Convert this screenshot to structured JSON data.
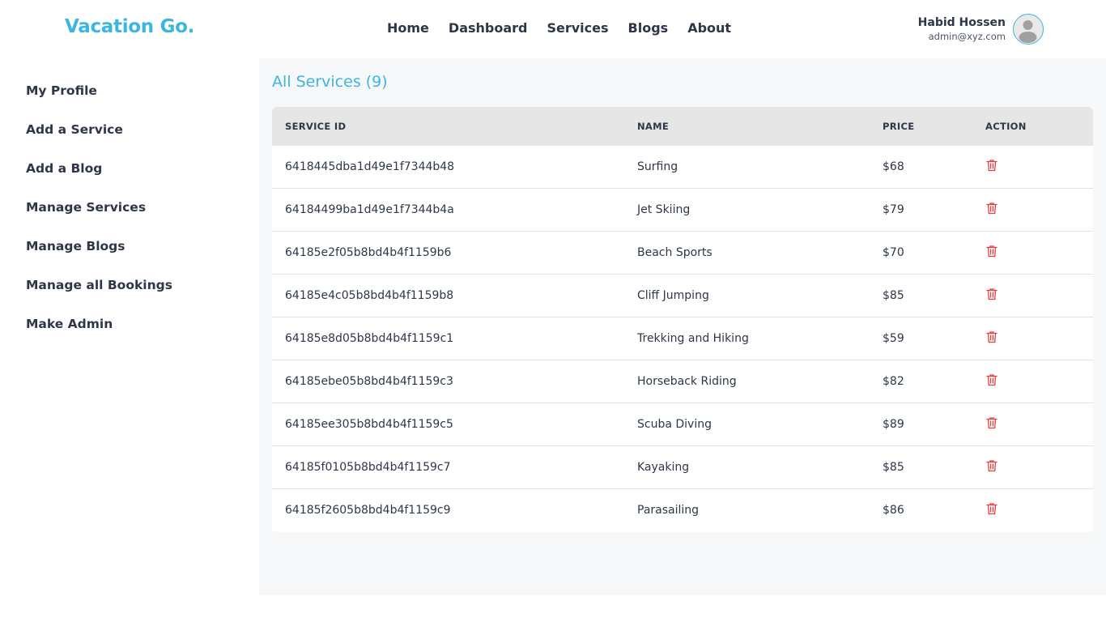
{
  "brand": {
    "logo": "Vacation Go.",
    "accent": "#3bb6e0"
  },
  "nav": {
    "items": [
      {
        "label": "Home"
      },
      {
        "label": "Dashboard"
      },
      {
        "label": "Services"
      },
      {
        "label": "Blogs"
      },
      {
        "label": "About"
      }
    ]
  },
  "user": {
    "name": "Habid Hossen",
    "email": "admin@xyz.com",
    "avatar_icon": "user-avatar-icon"
  },
  "sidebar": {
    "items": [
      {
        "label": "My Profile"
      },
      {
        "label": "Add a Service"
      },
      {
        "label": "Add a Blog"
      },
      {
        "label": "Manage Services"
      },
      {
        "label": "Manage Blogs"
      },
      {
        "label": "Manage all Bookings"
      },
      {
        "label": "Make Admin"
      }
    ]
  },
  "main": {
    "title": "All Services (9)",
    "table": {
      "headers": {
        "id": "SERVICE ID",
        "name": "NAME",
        "price": "PRICE",
        "action": "ACTION"
      },
      "delete_icon": "trash-icon",
      "delete_color": "#e53e3e",
      "rows": [
        {
          "id": "6418445dba1d49e1f7344b48",
          "name": "Surfing",
          "price": "$68"
        },
        {
          "id": "64184499ba1d49e1f7344b4a",
          "name": "Jet Skiing",
          "price": "$79"
        },
        {
          "id": "64185e2f05b8bd4b4f1159b6",
          "name": "Beach Sports",
          "price": "$70"
        },
        {
          "id": "64185e4c05b8bd4b4f1159b8",
          "name": "Cliff Jumping",
          "price": "$85"
        },
        {
          "id": "64185e8d05b8bd4b4f1159c1",
          "name": "Trekking and Hiking",
          "price": "$59"
        },
        {
          "id": "64185ebe05b8bd4b4f1159c3",
          "name": "Horseback Riding",
          "price": "$82"
        },
        {
          "id": "64185ee305b8bd4b4f1159c5",
          "name": "Scuba Diving",
          "price": "$89"
        },
        {
          "id": "64185f0105b8bd4b4f1159c7",
          "name": "Kayaking",
          "price": "$85"
        },
        {
          "id": "64185f2605b8bd4b4f1159c9",
          "name": "Parasailing",
          "price": "$86"
        }
      ]
    }
  }
}
